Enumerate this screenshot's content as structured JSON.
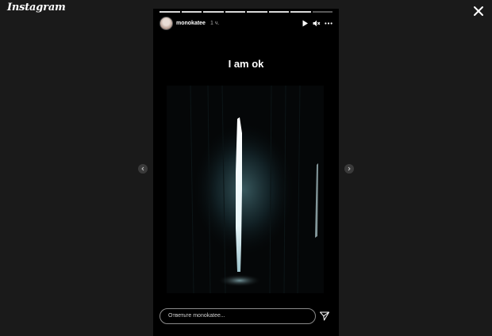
{
  "app": {
    "logo_text": "Instagram"
  },
  "story": {
    "progress_segments": 8,
    "active_segment": 7,
    "username": "monokatee",
    "time": "1 ч.",
    "caption": "I am ok",
    "reply_placeholder": "Ответьте monokatee..."
  },
  "icons": {
    "close": "close-icon",
    "play": "play-icon",
    "mute": "mute-icon",
    "more": "more-icon",
    "prev": "chevron-left-icon",
    "next": "chevron-right-icon",
    "send": "send-icon"
  },
  "colors": {
    "page_background": "#1a1a1a",
    "story_background": "#000000",
    "text": "#ffffff"
  }
}
